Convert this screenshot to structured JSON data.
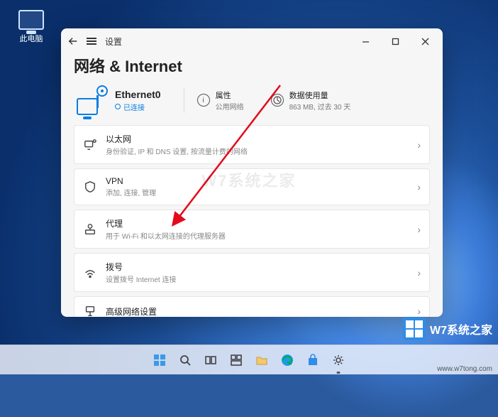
{
  "desktop": {
    "this_pc": "此电脑"
  },
  "window": {
    "titlebar": {
      "title": "设置"
    },
    "page_title": "网络 & Internet",
    "connection": {
      "name": "Ethernet0",
      "status": "已连接"
    },
    "properties": {
      "title": "属性",
      "subtitle": "公用网络"
    },
    "data_usage": {
      "title": "数据使用量",
      "subtitle": "863 MB, 过去 30 天"
    },
    "items": [
      {
        "title": "以太网",
        "subtitle": "身份验证, IP 和 DNS 设置, 按流量计费的网络"
      },
      {
        "title": "VPN",
        "subtitle": "添加, 连接, 管理"
      },
      {
        "title": "代理",
        "subtitle": "用于 Wi-Fi 和以太网连接的代理服务器"
      },
      {
        "title": "拨号",
        "subtitle": "设置拨号 Internet 连接"
      },
      {
        "title": "高级网络设置",
        "subtitle": ""
      }
    ]
  },
  "watermark": {
    "text": "W7系统之家",
    "url": "www.w7tong.com",
    "center": "W7系统之家"
  }
}
